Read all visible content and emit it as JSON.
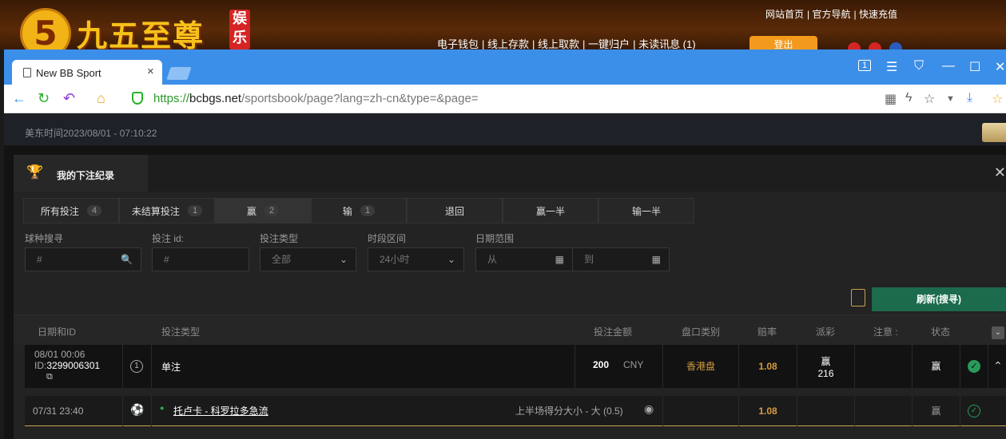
{
  "site": {
    "logo_digit": "5",
    "logo_text": "九五至尊",
    "logo_badge": "娱乐",
    "top_links": [
      "网站首页",
      "官方导航",
      "快速充值"
    ],
    "nav_links": [
      "电子钱包",
      "线上存款",
      "线上取款",
      "一键归户",
      "未读讯息 (1)"
    ],
    "login_button": "登出"
  },
  "browser": {
    "tab_title": "New BB Sport",
    "tab_number": "1",
    "url_proto": "https://",
    "url_host": "bcbgs.net",
    "url_path": "/sportsbook/page?lang=zh-cn&type=&page="
  },
  "page": {
    "time_text": "美东时间2023/08/01 - 07:10:22",
    "panel_title": "我的下注纪录",
    "filter_tabs": [
      {
        "label": "所有投注",
        "count": "4"
      },
      {
        "label": "未结算投注",
        "count": "1"
      },
      {
        "label": "赢",
        "count": "2"
      },
      {
        "label": "输",
        "count": "1"
      },
      {
        "label": "退回",
        "count": ""
      },
      {
        "label": "赢一半",
        "count": ""
      },
      {
        "label": "输一半",
        "count": ""
      }
    ],
    "filters": {
      "sport_label": "球种搜寻",
      "sport_placeholder": "#",
      "betid_label": "投注 id:",
      "betid_placeholder": "#",
      "type_label": "投注类型",
      "type_value": "全部",
      "period_label": "时段区间",
      "period_value": "24小时",
      "date_label": "日期范围",
      "date_from": "从",
      "date_to": "到"
    },
    "refresh_button": "刷新(搜寻)",
    "columns": [
      "日期和ID",
      "投注类型",
      "投注金额",
      "盘口类别",
      "赔率",
      "派彩",
      "注意 :",
      "状态"
    ],
    "bet": {
      "date": "08/01 00:06",
      "id_label": "ID:",
      "id": "3299006301",
      "index": "1",
      "type": "单注",
      "amount": "200",
      "currency": "CNY",
      "market": "香港盘",
      "odds": "1.08",
      "payout_label": "赢",
      "payout_value": "216",
      "status": "赢"
    },
    "leg": {
      "date": "07/31 23:40",
      "match": "托卢卡 - 科罗拉多急流",
      "selection": "上半场得分大小 - 大 (0.5)",
      "odds": "1.08",
      "status": "赢"
    }
  }
}
